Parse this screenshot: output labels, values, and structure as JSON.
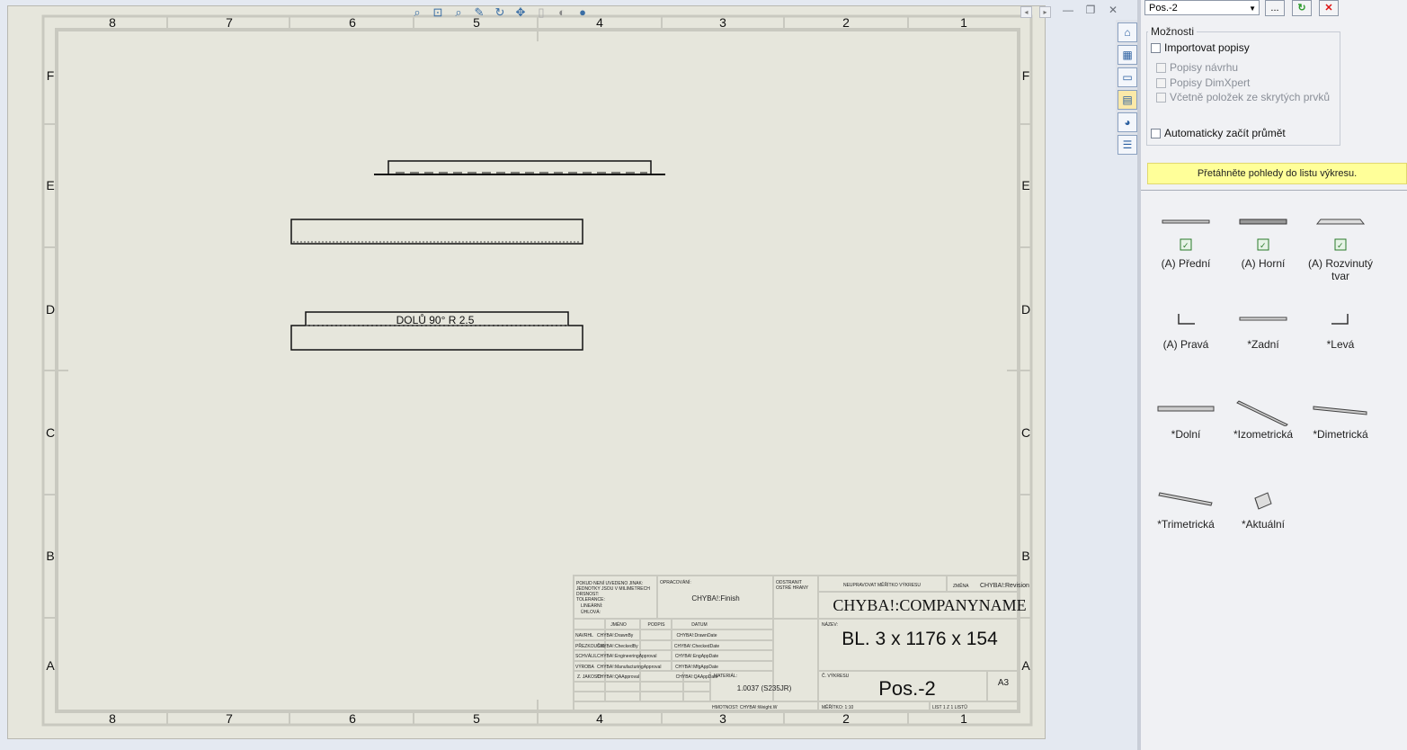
{
  "sheet": {
    "columns": [
      "8",
      "7",
      "6",
      "5",
      "4",
      "3",
      "2",
      "1"
    ],
    "rows": [
      "F",
      "E",
      "D",
      "C",
      "B",
      "A"
    ],
    "view_note": "DOLŮ  90°  R 2.5"
  },
  "title_block": {
    "general_note": [
      "POKUD NENÍ UVEDENO JINAK:",
      "JEDNOTKY JSOU V MILIMETRECH",
      "DRSNOST:",
      "TOLERANCE:",
      "LINEÁRNÍ:",
      "ÚHLOVÁ:"
    ],
    "finish_label": "OPRACOVÁNÍ:",
    "finish_value": "CHYBA!:Finish",
    "edges_label": [
      "ODSTRANIT",
      "OSTRÉ HRANY"
    ],
    "no_scale": "NEUPRAVOVAT MĚŘÍTKO VÝKRESU",
    "revision_label": "ZMĚNA",
    "revision_value": "CHYBA!:Revision",
    "company": "CHYBA!:COMPANYNAME",
    "name_label": "NÁZEV:",
    "title": "BL. 3 x 1176 x 154",
    "col_headers": [
      "JMÉNO",
      "PODPIS",
      "DATUM"
    ],
    "rows": [
      {
        "role": "NAVRHL",
        "name": "CHYBA!:DrawnBy",
        "date": "CHYBA!:DrawnDate"
      },
      {
        "role": "PŘEZKOUŠEL",
        "name": "CHYBA!:CheckedBy",
        "date": "CHYBA!:CheckedDate"
      },
      {
        "role": "SCHVÁLIL",
        "name": "CHYBA!:EngineeringApproval",
        "date": "CHYBA!:EngAppDate"
      },
      {
        "role": "VÝROBA",
        "name": "CHYBA!:ManufacturingApproval",
        "date": "CHYBA!:MfgAppDate"
      },
      {
        "role": "Z. JAKOSTI",
        "name": "CHYBA!:QAApproval",
        "date": "CHYBA!:QAAppDate"
      }
    ],
    "material_label": "MATERIÁL:",
    "material": "1.0037 (S235JR)",
    "dwg_no_label": "Č. VÝKRESU",
    "dwg_no": "Pos.-2",
    "size": "A3",
    "weight": "HMOTNOST: CHYBA!:Weight.W",
    "scale": "MĚŘÍTKO: 1:10",
    "sheet_of": "LIST 1 Z 1 LISTŮ"
  },
  "panel": {
    "sheet_combo": "Pos.-2",
    "browse_label": "...",
    "options_title": "Možnosti",
    "options": [
      {
        "label": "Importovat popisy",
        "checked": false,
        "disabled": false
      },
      {
        "label": "Popisy návrhu",
        "checked": false,
        "disabled": true
      },
      {
        "label": "Popisy DimXpert",
        "checked": false,
        "disabled": true
      },
      {
        "label": "Včetně položek ze skrytých prvků",
        "checked": false,
        "disabled": true
      },
      {
        "label": "Automaticky začít průmět",
        "checked": false,
        "disabled": false
      }
    ],
    "hint": "Přetáhněte pohledy do listu výkresu.",
    "views": [
      {
        "label": "(A) Přední",
        "icon": "front-view-icon"
      },
      {
        "label": "(A) Horní",
        "icon": "top-view-icon"
      },
      {
        "label": "(A) Rozvinutý tvar",
        "icon": "flat-pattern-icon"
      },
      {
        "label": "(A) Pravá",
        "icon": "right-view-icon"
      },
      {
        "label": "*Zadní",
        "icon": "back-view-icon"
      },
      {
        "label": "*Levá",
        "icon": "left-view-icon"
      },
      {
        "label": "*Dolní",
        "icon": "bottom-view-icon"
      },
      {
        "label": "*Izometrická",
        "icon": "isometric-view-icon"
      },
      {
        "label": "*Dimetrická",
        "icon": "dimetric-view-icon"
      },
      {
        "label": "*Trimetrická",
        "icon": "trimetric-view-icon"
      },
      {
        "label": "*Aktuální",
        "icon": "current-view-icon"
      }
    ]
  }
}
